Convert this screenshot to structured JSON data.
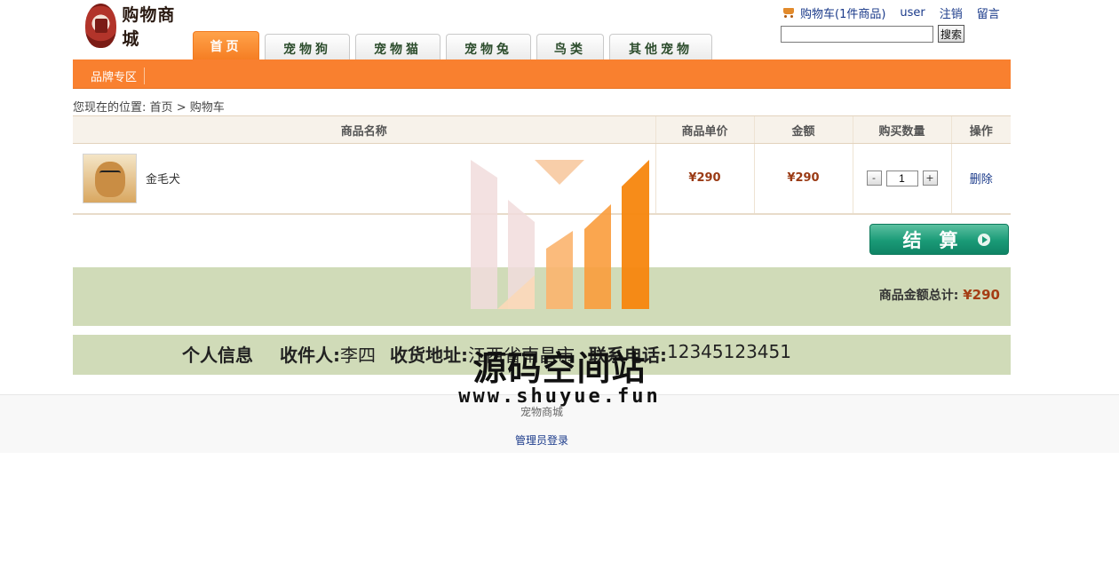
{
  "header": {
    "logo_text": "购物商城",
    "cart_link": "购物车(1件商品)",
    "user_link": "user",
    "logout_link": "注销",
    "message_link": "留言",
    "search_placeholder": "",
    "search_button": "搜索"
  },
  "nav": {
    "tabs": [
      "首页",
      "宠物狗",
      "宠物猫",
      "宠物兔",
      "鸟类",
      "其他宠物"
    ],
    "active_tab": "首页",
    "brand_zone": "品牌专区"
  },
  "breadcrumb": {
    "prefix": "您现在的位置:",
    "home": "首页",
    "separator": ">",
    "current": "购物车"
  },
  "cart": {
    "columns": [
      "商品名称",
      "商品单价",
      "金额",
      "购买数量",
      "操作"
    ],
    "items": [
      {
        "name": "金毛犬",
        "unit_price": "¥290",
        "amount": "¥290",
        "quantity": "1",
        "action": "删除"
      }
    ],
    "minus_label": "-",
    "plus_label": "+",
    "checkout_label": "结算",
    "total_label": "商品金额总计:",
    "total_value": "¥290"
  },
  "personal_info": {
    "title": "个人信息",
    "receiver_label": "收件人:",
    "receiver_value": "李四",
    "address_label": "收货地址:",
    "address_value": "江西省南昌市",
    "phone_label": "联系电话:",
    "phone_value": "12345123451"
  },
  "footer": {
    "brand": "宠物商城",
    "admin_login": "管理员登录"
  },
  "watermark": {
    "text": "源码空间站",
    "url": "www.shuyue.fun"
  },
  "colors": {
    "orange_bar": "#f9802f",
    "info_bg": "#d0dbb8",
    "price": "#9a3a14",
    "checkout_green": "#1a9a77",
    "link_blue": "#1a3a8a"
  }
}
